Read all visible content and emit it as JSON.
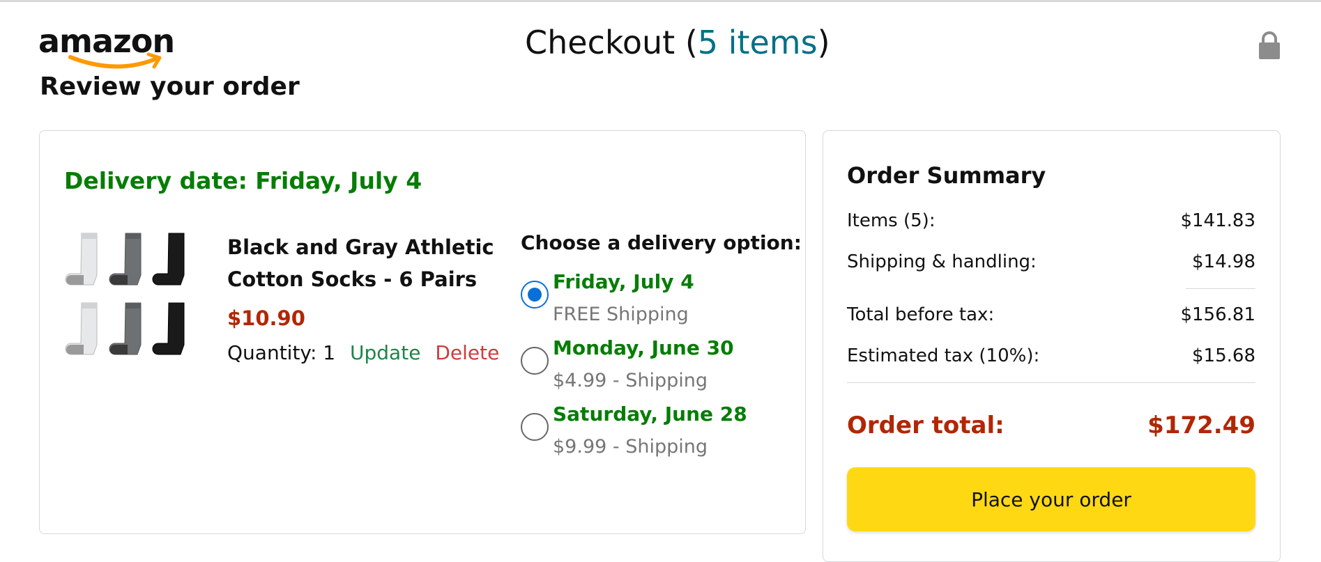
{
  "header": {
    "logo_text": "amazon",
    "title_prefix": "Checkout (",
    "title_count": "5 items",
    "title_suffix": ")",
    "lock_icon": "lock-icon"
  },
  "page": {
    "review_title": "Review your order"
  },
  "order": {
    "delivery_date": "Delivery date: Friday, July 4",
    "product": {
      "title": "Black and Gray Athletic Cotton Socks - 6 Pairs",
      "price": "$10.90",
      "quantity_label": "Quantity: 1",
      "update_label": "Update",
      "delete_label": "Delete",
      "image_icon": "socks-product-image"
    },
    "delivery_heading": "Choose a delivery option:",
    "options": [
      {
        "date": "Friday, July 4",
        "shipping": "FREE Shipping",
        "selected": true
      },
      {
        "date": "Monday, June 30",
        "shipping": "$4.99 - Shipping",
        "selected": false
      },
      {
        "date": "Saturday, June 28",
        "shipping": "$9.99 - Shipping",
        "selected": false
      }
    ]
  },
  "summary": {
    "title": "Order Summary",
    "rows": [
      {
        "label": "Items (5):",
        "value": "$141.83"
      },
      {
        "label": "Shipping & handling:",
        "value": "$14.98"
      },
      {
        "label": "Total before tax:",
        "value": "$156.81"
      },
      {
        "label": "Estimated tax (10%):",
        "value": "$15.68"
      }
    ],
    "total_label": "Order total:",
    "total_value": "$172.49",
    "place_order_label": "Place your order"
  },
  "colors": {
    "accent_green": "#067d06",
    "price_red": "#b12704",
    "link_teal": "#007185",
    "button_yellow": "#ffd814",
    "radio_blue": "#0b6fd8"
  }
}
